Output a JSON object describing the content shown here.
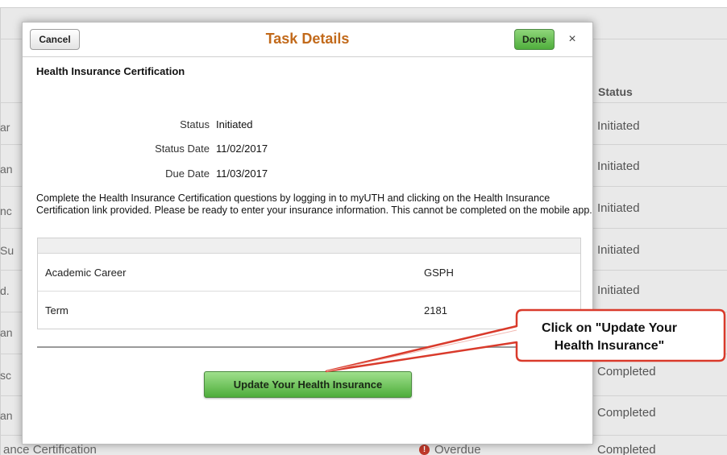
{
  "background": {
    "status_header": "Status",
    "left_fragments": [
      "ar",
      "an",
      "nc",
      "Su",
      "d.",
      "an",
      "sc",
      "an"
    ],
    "statuses": [
      "Initiated",
      "Initiated",
      "Initiated",
      "Initiated",
      "Initiated",
      "Completed",
      "Completed",
      "Completed"
    ],
    "bottom_row": {
      "name": "ance Certification",
      "status": "Overdue",
      "status_icon": "alert-icon",
      "last_status": "Completed"
    }
  },
  "modal": {
    "cancel_label": "Cancel",
    "title": "Task Details",
    "done_label": "Done",
    "close_glyph": "×",
    "task_title": "Health Insurance Certification",
    "fields": [
      {
        "label": "Status",
        "value": "Initiated"
      },
      {
        "label": "Status Date",
        "value": "11/02/2017"
      },
      {
        "label": "Due Date",
        "value": "11/03/2017"
      }
    ],
    "instructions": "Complete the Health Insurance Certification questions by logging in to myUTH and clicking on the Health Insurance Certification link provided. Please be ready to enter your insurance information. This cannot be completed on the mobile app.",
    "details": [
      {
        "key": "Academic Career",
        "value": "GSPH"
      },
      {
        "key": "Term",
        "value": "2181"
      }
    ],
    "update_button_label": "Update Your Health Insurance"
  },
  "callout": {
    "line1": "Click on \"Update Your",
    "line2": "Health Insurance\""
  },
  "colors": {
    "title_orange": "#c26a1b",
    "green_button": "#4fae3c",
    "callout_red": "#d93a2b",
    "overdue_red": "#c0392b"
  }
}
